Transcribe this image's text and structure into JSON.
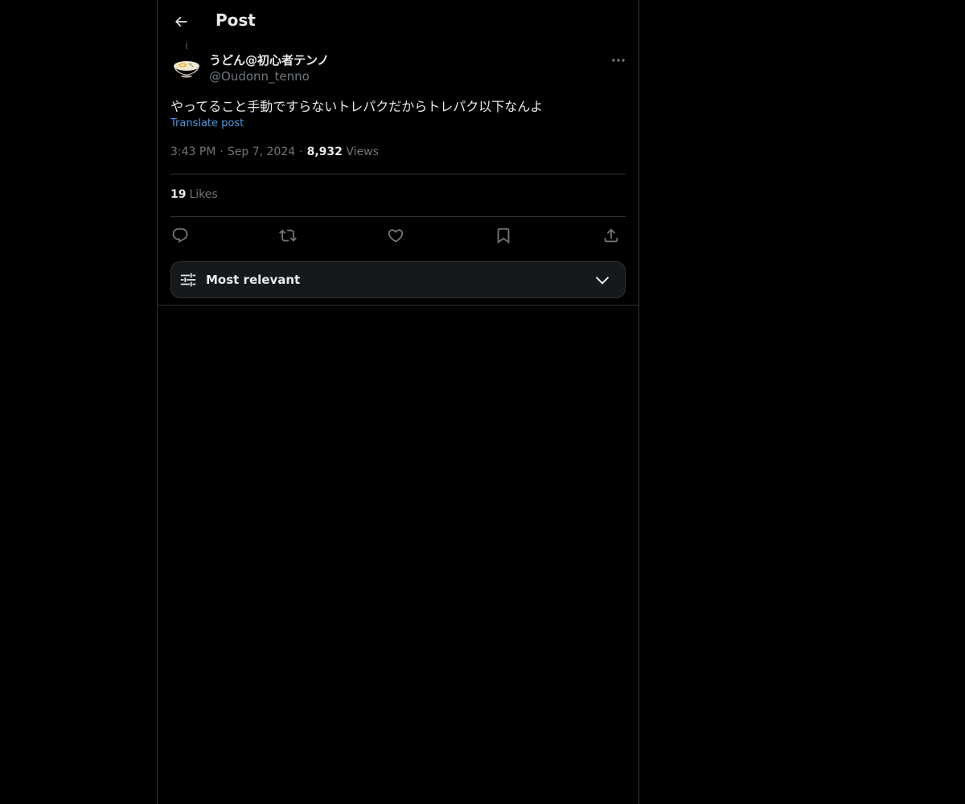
{
  "header": {
    "title": "Post",
    "back_icon": "arrow-left-icon"
  },
  "post": {
    "author": {
      "display_name": "うどん@初心者テンノ",
      "handle": "@Oudonn_tenno",
      "avatar_icon": "udon-bowl-icon"
    },
    "text": "やってること手動ですらないトレパクだからトレパク以下なんよ",
    "translate_label": "Translate post",
    "time": "3:43 PM",
    "date": "Sep 7, 2024",
    "views_count": "8,932",
    "views_label": "Views",
    "likes_count": "19",
    "likes_label": "Likes"
  },
  "actions": {
    "icons": [
      "reply-icon",
      "repost-icon",
      "like-icon",
      "bookmark-icon",
      "share-icon"
    ]
  },
  "sort": {
    "label": "Most relevant"
  },
  "colors": {
    "background": "#000000",
    "text": "#e7e9ea",
    "secondary_text": "#71767b",
    "link": "#4a99e9",
    "border": "#2f3336"
  }
}
